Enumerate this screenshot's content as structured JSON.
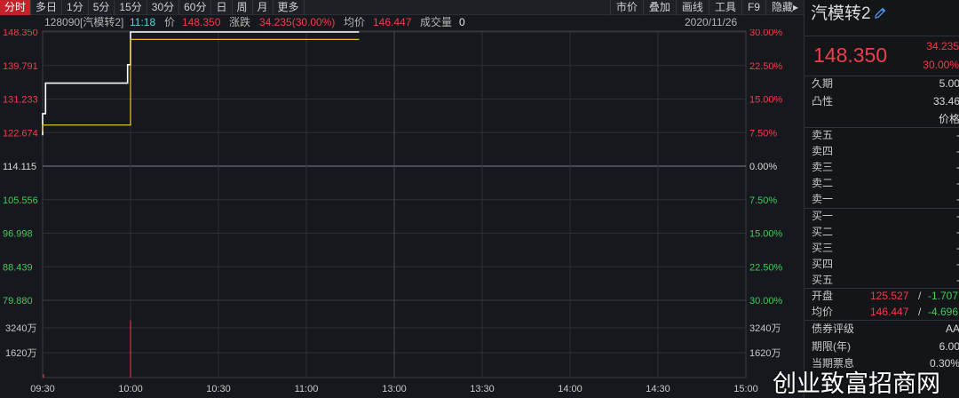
{
  "tabs": [
    {
      "label": "分时",
      "active": true
    },
    {
      "label": "多日",
      "active": false
    },
    {
      "label": "1分",
      "active": false
    },
    {
      "label": "5分",
      "active": false
    },
    {
      "label": "15分",
      "active": false
    },
    {
      "label": "30分",
      "active": false
    },
    {
      "label": "60分",
      "active": false
    },
    {
      "label": "日",
      "active": false
    },
    {
      "label": "周",
      "active": false
    },
    {
      "label": "月",
      "active": false
    },
    {
      "label": "更多",
      "active": false
    }
  ],
  "tools": [
    "市价",
    "叠加",
    "画线",
    "工具",
    "F9",
    "隐藏▸"
  ],
  "info": {
    "code_name": "128090[汽模转2]",
    "time": "11:18",
    "price_label": "价",
    "price": "148.350",
    "change_label": "涨跌",
    "change": "34.235(30.00%)",
    "avg_label": "均价",
    "avg": "146.447",
    "volume_label": "成交量",
    "volume": "0",
    "date": "2020/11/26"
  },
  "colors": {
    "up": "#ef3e4a",
    "down": "#3fcb5b",
    "price_line": "#ffffff",
    "avg_line": "#e5b830",
    "grid": "#2d3038",
    "active_tab": "#c6202a"
  },
  "chart_data": {
    "type": "line",
    "title": "",
    "base_price": 114.115,
    "ylim": [
      79.88,
      148.35
    ],
    "price_ticks": [
      {
        "value": "148.350",
        "dir": "up"
      },
      {
        "value": "139.791",
        "dir": "up"
      },
      {
        "value": "131.233",
        "dir": "up"
      },
      {
        "value": "122.674",
        "dir": "up"
      },
      {
        "value": "114.115",
        "dir": "flat"
      },
      {
        "value": "105.556",
        "dir": "down"
      },
      {
        "value": "96.998",
        "dir": "down"
      },
      {
        "value": "88.439",
        "dir": "down"
      },
      {
        "value": "79.880",
        "dir": "down"
      }
    ],
    "pct_ticks": [
      {
        "value": "30.00%",
        "dir": "up"
      },
      {
        "value": "22.50%",
        "dir": "up"
      },
      {
        "value": "15.00%",
        "dir": "up"
      },
      {
        "value": "7.50%",
        "dir": "up"
      },
      {
        "value": "0.00%",
        "dir": "flat"
      },
      {
        "value": "7.50%",
        "dir": "down"
      },
      {
        "value": "15.00%",
        "dir": "down"
      },
      {
        "value": "22.50%",
        "dir": "down"
      },
      {
        "value": "30.00%",
        "dir": "down"
      }
    ],
    "volume_ticks": [
      "3240万",
      "1620万"
    ],
    "x_ticks": [
      "09:30",
      "10:00",
      "10:30",
      "11:00",
      "13:00",
      "13:30",
      "14:00",
      "14:30",
      "15:00"
    ],
    "series": [
      {
        "key": "price",
        "x_minutes": [
          0,
          0,
          1,
          1,
          29,
          29,
          30,
          30,
          108
        ],
        "values": [
          122.0,
          127.5,
          127.5,
          135.3,
          135.3,
          140.0,
          140.0,
          148.35,
          148.35
        ]
      },
      {
        "key": "avg",
        "x_minutes": [
          0,
          0,
          1,
          29,
          30,
          30,
          31,
          108
        ],
        "values": [
          123.0,
          124.6,
          124.6,
          124.6,
          124.6,
          146.447,
          146.447,
          146.447
        ]
      }
    ],
    "volume_bars": [
      {
        "x_minute": 0,
        "value": 200
      },
      {
        "x_minute": 30,
        "value": 3600
      }
    ],
    "volume_max": 4860
  },
  "panel": {
    "title": "汽模转2",
    "price": "148.350",
    "change_abs": "34.235",
    "change_pct": "30.00%",
    "stats1": [
      {
        "label": "久期",
        "value": "5.00"
      },
      {
        "label": "凸性",
        "value": "33.46"
      }
    ],
    "header_price": "价格",
    "asks": [
      {
        "label": "卖五",
        "value": "-"
      },
      {
        "label": "卖四",
        "value": "-"
      },
      {
        "label": "卖三",
        "value": "-"
      },
      {
        "label": "卖二",
        "value": "-"
      },
      {
        "label": "卖一",
        "value": "-"
      }
    ],
    "bids": [
      {
        "label": "买一",
        "value": "-"
      },
      {
        "label": "买二",
        "value": "-"
      },
      {
        "label": "买三",
        "value": "-"
      },
      {
        "label": "买四",
        "value": "-"
      },
      {
        "label": "买五",
        "value": "-"
      }
    ],
    "open": {
      "label": "开盘",
      "v1": "125.527",
      "slash": "/",
      "v2": "-1.707"
    },
    "avg": {
      "label": "均价",
      "v1": "146.447",
      "slash": "/",
      "v2": "-4.696"
    },
    "stats2": [
      {
        "label": "债券评级",
        "value": "AA"
      },
      {
        "label": "期限(年)",
        "value": "6.00"
      },
      {
        "label": "当期票息",
        "value": "0.30%"
      }
    ]
  },
  "watermark": "创业致富招商网"
}
